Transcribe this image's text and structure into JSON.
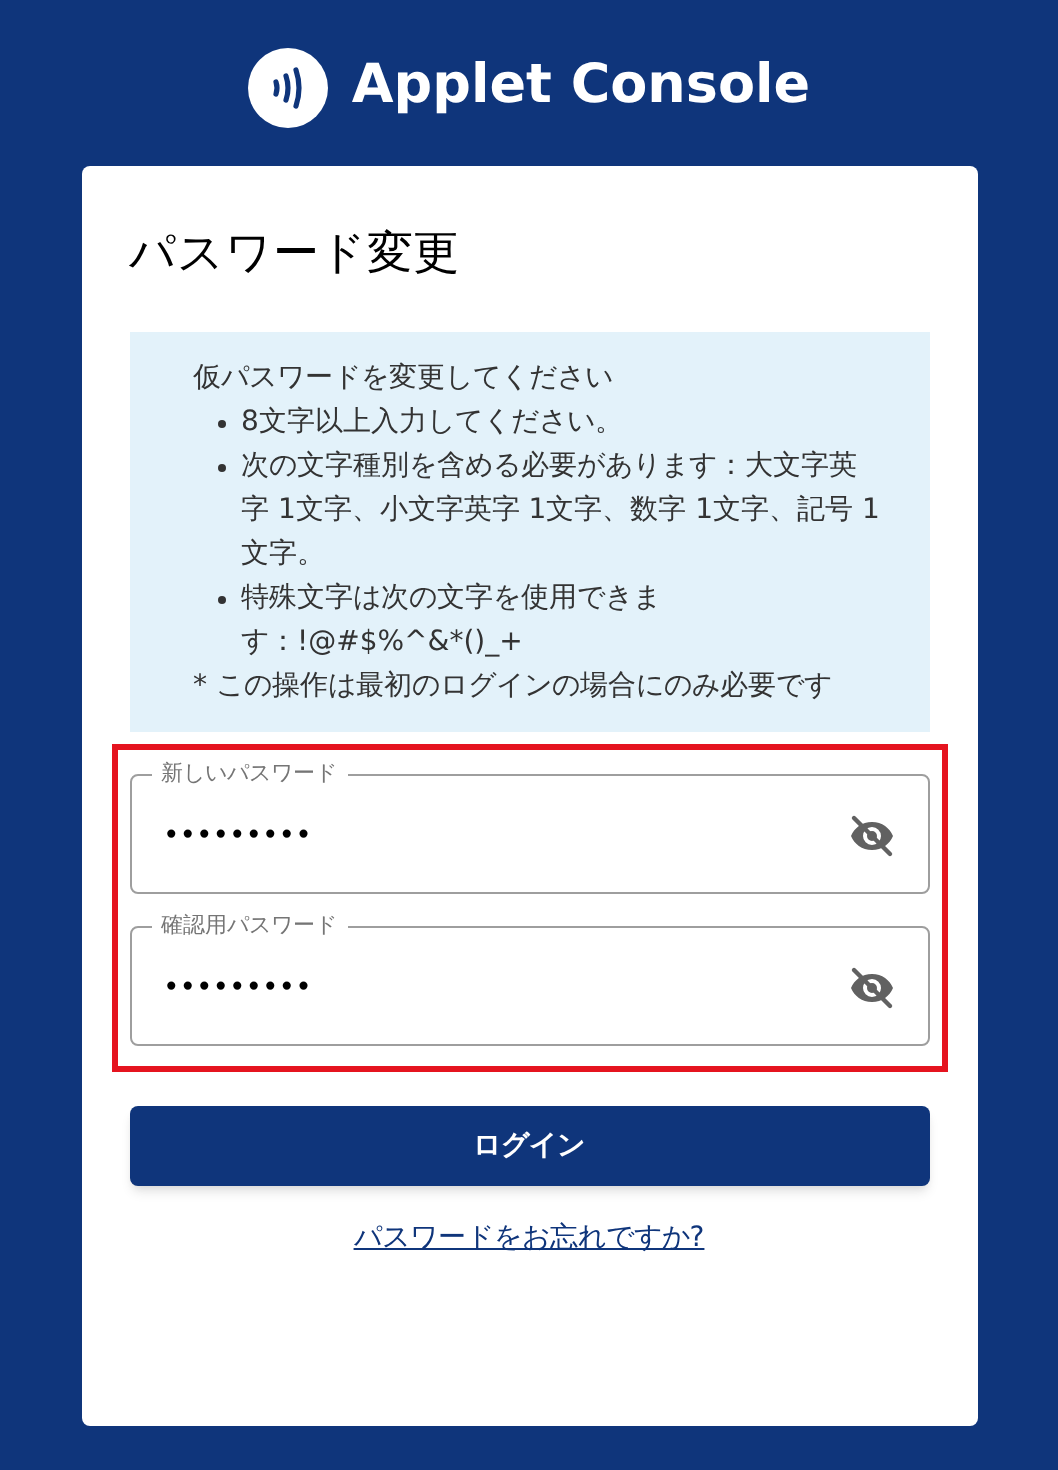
{
  "brand": {
    "title": "Applet Console"
  },
  "card": {
    "title": "パスワード変更",
    "notice": {
      "heading": "仮パスワードを変更してください",
      "bullets": [
        "8文字以上入力してください。",
        "次の文字種別を含める必要があります：大文字英字 1文字、小文字英字 1文字、数字 1文字、記号 1文字。",
        "特殊文字は次の文字を使用できます：!@#$%^&*()_+"
      ],
      "footnote": "* この操作は最初のログインの場合にのみ必要です"
    },
    "fields_group": {
      "highlighted": true,
      "fields": [
        {
          "label": "新しいパスワード",
          "value": "•••••••••",
          "visible": false
        },
        {
          "label": "確認用パスワード",
          "value": "•••••••••",
          "visible": false
        }
      ]
    },
    "login_button": "ログイン",
    "forgot_link": "パスワードをお忘れですか?"
  }
}
